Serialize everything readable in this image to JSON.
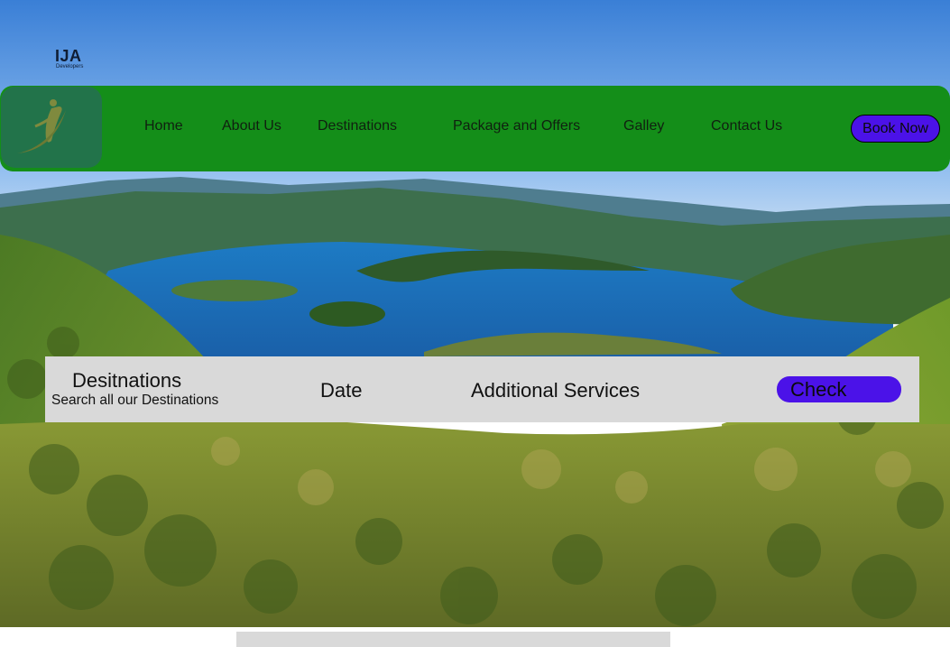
{
  "brand": {
    "logo_text": "IJA",
    "logo_subtext": "Developers"
  },
  "nav": {
    "items": [
      {
        "label": "Home"
      },
      {
        "label": "About Us"
      },
      {
        "label": "Destinations"
      },
      {
        "label": "Package and Offers"
      },
      {
        "label": "Galley"
      },
      {
        "label": "Contact Us"
      }
    ],
    "book_label": "Book Now"
  },
  "search": {
    "destinations_title": "Desitnations",
    "destinations_sub": "Search all our Destinations",
    "date_label": "Date",
    "services_label": "Additional Services",
    "check_label": "Check"
  },
  "icons": {
    "logo": "person-swoosh-logo-icon"
  },
  "colors": {
    "nav_bg": "#148e19",
    "logo_bg": "#22734a",
    "button_bg": "#4b12e8",
    "search_bg": "#d9d9d9"
  }
}
